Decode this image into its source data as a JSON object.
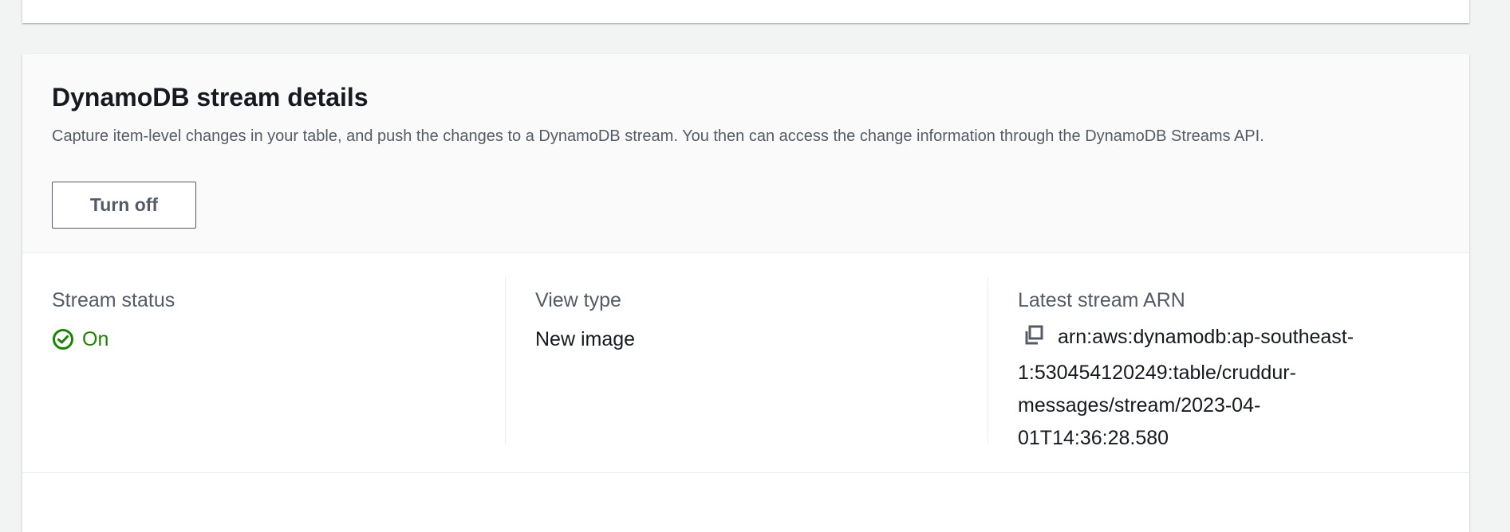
{
  "panel": {
    "title": "DynamoDB stream details",
    "description": "Capture item-level changes in your table, and push the changes to a DynamoDB stream. You then can access the change information through the DynamoDB Streams API.",
    "turn_off_label": "Turn off"
  },
  "details": {
    "stream_status": {
      "label": "Stream status",
      "value": "On",
      "icon": "check-circle-icon",
      "color": "#1d8102"
    },
    "view_type": {
      "label": "View type",
      "value": "New image"
    },
    "latest_stream_arn": {
      "label": "Latest stream ARN",
      "value": "arn:aws:dynamodb:ap-southeast-1:530454120249:table/cruddur-messages/stream/2023-04-01T14:36:28.580",
      "icon": "copy-icon"
    }
  }
}
